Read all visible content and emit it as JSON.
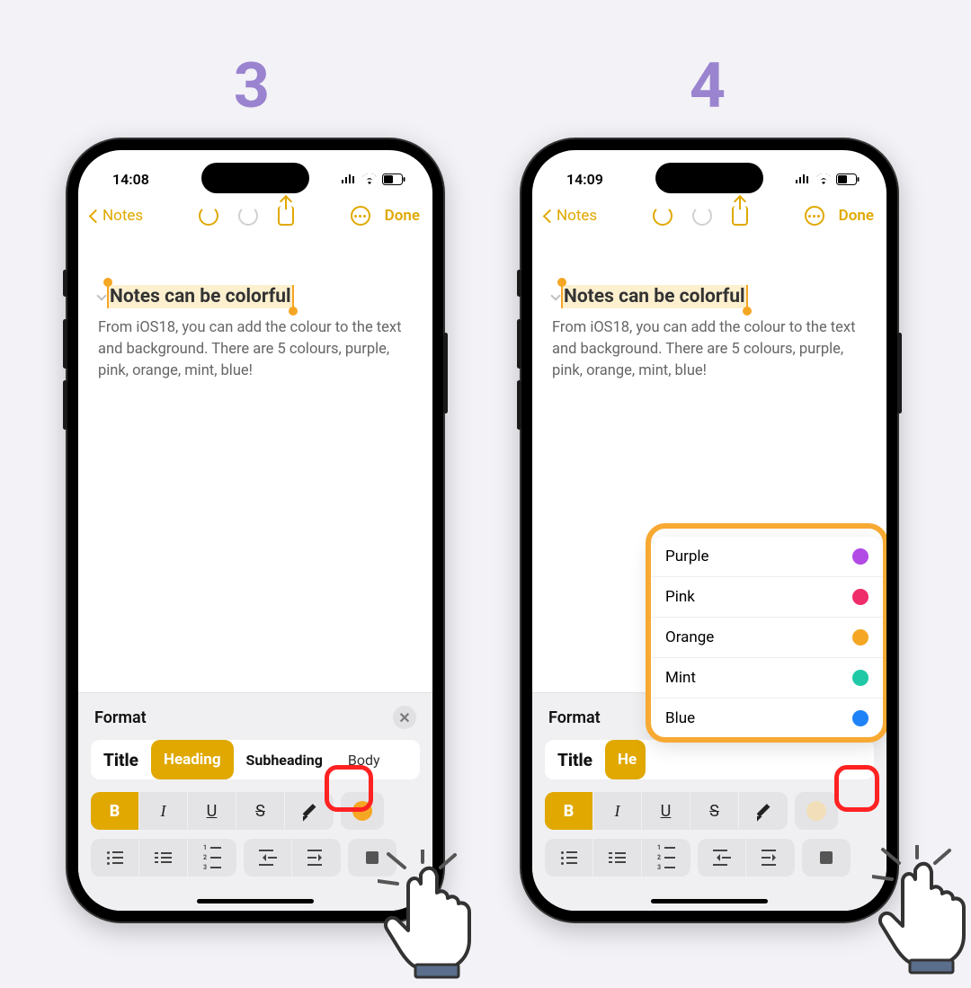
{
  "steps": {
    "left": "3",
    "right": "4"
  },
  "accent": "#e0a800",
  "status": {
    "time_left": "14:08",
    "time_right": "14:09"
  },
  "nav": {
    "back_label": "Notes",
    "done_label": "Done"
  },
  "note": {
    "title": "Notes can be colorful",
    "body": "From iOS18, you can add the colour to the text and background. There are 5 colours, purple, pink, orange, mint, blue!"
  },
  "format": {
    "panel_title": "Format",
    "styles": {
      "title": "Title",
      "heading": "Heading",
      "subheading": "Subheading",
      "body": "Body"
    },
    "style_selected": "Heading",
    "biu": {
      "b": "B",
      "i": "I",
      "u": "U",
      "s": "S"
    },
    "bold_selected": true,
    "color_swatch": "#f5a623",
    "color_swatch_right": "#f2dfba"
  },
  "colors_popover": [
    {
      "label": "Purple",
      "hex": "#b24ae6"
    },
    {
      "label": "Pink",
      "hex": "#ef2d6a"
    },
    {
      "label": "Orange",
      "hex": "#f5a623"
    },
    {
      "label": "Mint",
      "hex": "#1fc9a6"
    },
    {
      "label": "Blue",
      "hex": "#1f82f7"
    }
  ]
}
